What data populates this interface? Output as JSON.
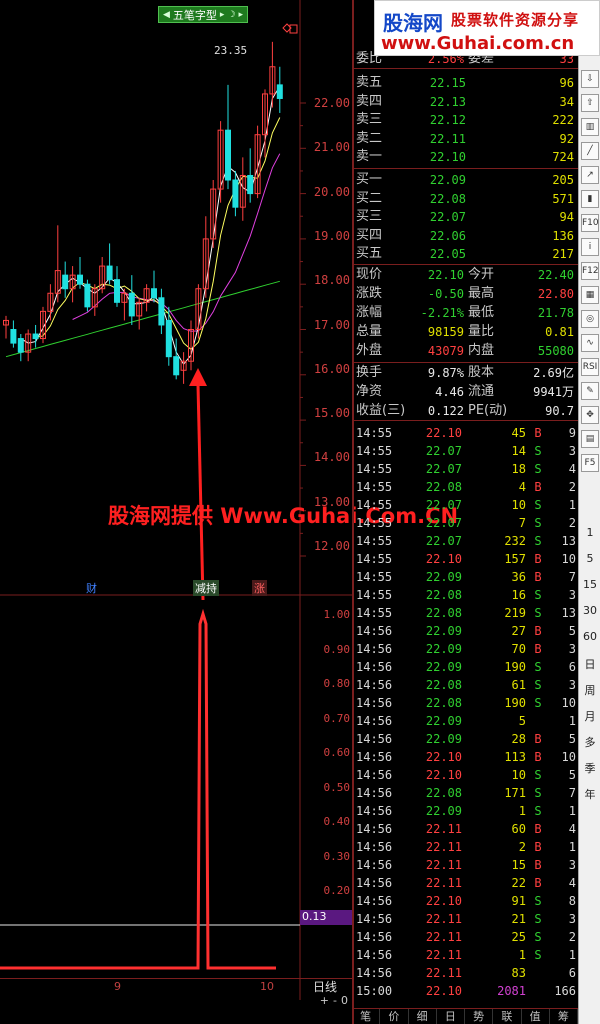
{
  "formula_button": {
    "label": "五笔字型"
  },
  "chart": {
    "price_axis": [
      "22.00",
      "21.00",
      "20.00",
      "19.00",
      "18.00",
      "17.00",
      "16.00",
      "15.00",
      "14.00",
      "13.00",
      "12.00"
    ],
    "indicator_axis": [
      "1.00",
      "0.90",
      "0.80",
      "0.70",
      "0.60",
      "0.50",
      "0.40",
      "0.30",
      "0.20"
    ],
    "high_label": "23.35",
    "events": [
      {
        "label": "财",
        "color": "#4080ff"
      },
      {
        "label": "减持",
        "color": "#ffffff"
      },
      {
        "label": "涨",
        "color": "#ff6060"
      }
    ],
    "indicator_value": "0.13",
    "dates": [
      "9",
      "10"
    ],
    "period_label": "日线",
    "zoom": [
      "+",
      "-",
      "0"
    ],
    "watermark": "股海网提供 Www.Guhai.Com.CN",
    "colors": {
      "up": "#ff4040",
      "down": "#20e0e0",
      "ma5": "#ffffff",
      "ma10": "#ffff60",
      "ma20": "#e040e0",
      "ma60": "#30d030",
      "indicator": "#ff3030"
    }
  },
  "logo": {
    "brand": "股海网",
    "slogan": "股票软件资源分享",
    "url": "www.Guhai.com.cn"
  },
  "quote": {
    "weibi": {
      "label": "委比",
      "value": "2.56%",
      "label2": "委差",
      "value2": "33"
    },
    "asks": [
      {
        "label": "卖五",
        "price": "22.15",
        "vol": "96"
      },
      {
        "label": "卖四",
        "price": "22.13",
        "vol": "34"
      },
      {
        "label": "卖三",
        "price": "22.12",
        "vol": "222"
      },
      {
        "label": "卖二",
        "price": "22.11",
        "vol": "92"
      },
      {
        "label": "卖一",
        "price": "22.10",
        "vol": "724"
      }
    ],
    "bids": [
      {
        "label": "买一",
        "price": "22.09",
        "vol": "205"
      },
      {
        "label": "买二",
        "price": "22.08",
        "vol": "571"
      },
      {
        "label": "买三",
        "price": "22.07",
        "vol": "94"
      },
      {
        "label": "买四",
        "price": "22.06",
        "vol": "136"
      },
      {
        "label": "买五",
        "price": "22.05",
        "vol": "217"
      }
    ],
    "stats1": [
      {
        "l1": "现价",
        "v1": "22.10",
        "c1": "green",
        "l2": "今开",
        "v2": "22.40",
        "c2": "green"
      },
      {
        "l1": "涨跌",
        "v1": "-0.50",
        "c1": "green",
        "l2": "最高",
        "v2": "22.80",
        "c2": "red"
      },
      {
        "l1": "涨幅",
        "v1": "-2.21%",
        "c1": "green",
        "l2": "最低",
        "v2": "21.78",
        "c2": "green"
      },
      {
        "l1": "总量",
        "v1": "98159",
        "c1": "yellow",
        "l2": "量比",
        "v2": "0.81",
        "c2": "yellow"
      },
      {
        "l1": "外盘",
        "v1": "43079",
        "c1": "red",
        "l2": "内盘",
        "v2": "55080",
        "c2": "green"
      }
    ],
    "stats2": [
      {
        "l1": "换手",
        "v1": "9.87%",
        "l2": "股本",
        "v2": "2.69亿"
      },
      {
        "l1": "净资",
        "v1": "4.46",
        "l2": "流通",
        "v2": "9941万"
      },
      {
        "l1": "收益(三)",
        "v1": "0.122",
        "l2": "PE(动)",
        "v2": "90.7"
      }
    ]
  },
  "ticks": [
    {
      "t": "14:55",
      "p": "22.10",
      "v": "45",
      "s": "B",
      "n": "9"
    },
    {
      "t": "14:55",
      "p": "22.07",
      "v": "14",
      "s": "S",
      "n": "3"
    },
    {
      "t": "14:55",
      "p": "22.07",
      "v": "18",
      "s": "S",
      "n": "4"
    },
    {
      "t": "14:55",
      "p": "22.08",
      "v": "4",
      "s": "B",
      "n": "2"
    },
    {
      "t": "14:55",
      "p": "22.07",
      "v": "10",
      "s": "S",
      "n": "1"
    },
    {
      "t": "14:55",
      "p": "22.07",
      "v": "7",
      "s": "S",
      "n": "2"
    },
    {
      "t": "14:55",
      "p": "22.07",
      "v": "232",
      "s": "S",
      "n": "13"
    },
    {
      "t": "14:55",
      "p": "22.10",
      "v": "157",
      "s": "B",
      "n": "10"
    },
    {
      "t": "14:55",
      "p": "22.09",
      "v": "36",
      "s": "B",
      "n": "7"
    },
    {
      "t": "14:55",
      "p": "22.08",
      "v": "16",
      "s": "S",
      "n": "3"
    },
    {
      "t": "14:55",
      "p": "22.08",
      "v": "219",
      "s": "S",
      "n": "13"
    },
    {
      "t": "14:56",
      "p": "22.09",
      "v": "27",
      "s": "B",
      "n": "5"
    },
    {
      "t": "14:56",
      "p": "22.09",
      "v": "70",
      "s": "B",
      "n": "3"
    },
    {
      "t": "14:56",
      "p": "22.09",
      "v": "190",
      "s": "S",
      "n": "6"
    },
    {
      "t": "14:56",
      "p": "22.08",
      "v": "61",
      "s": "S",
      "n": "3"
    },
    {
      "t": "14:56",
      "p": "22.08",
      "v": "190",
      "s": "S",
      "n": "10"
    },
    {
      "t": "14:56",
      "p": "22.09",
      "v": "5",
      "s": "",
      "n": "1"
    },
    {
      "t": "14:56",
      "p": "22.09",
      "v": "28",
      "s": "B",
      "n": "5"
    },
    {
      "t": "14:56",
      "p": "22.10",
      "v": "113",
      "s": "B",
      "n": "10"
    },
    {
      "t": "14:56",
      "p": "22.10",
      "v": "10",
      "s": "S",
      "n": "5"
    },
    {
      "t": "14:56",
      "p": "22.08",
      "v": "171",
      "s": "S",
      "n": "7"
    },
    {
      "t": "14:56",
      "p": "22.09",
      "v": "1",
      "s": "S",
      "n": "1"
    },
    {
      "t": "14:56",
      "p": "22.11",
      "v": "60",
      "s": "B",
      "n": "4"
    },
    {
      "t": "14:56",
      "p": "22.11",
      "v": "2",
      "s": "B",
      "n": "1"
    },
    {
      "t": "14:56",
      "p": "22.11",
      "v": "15",
      "s": "B",
      "n": "3"
    },
    {
      "t": "14:56",
      "p": "22.11",
      "v": "22",
      "s": "B",
      "n": "4"
    },
    {
      "t": "14:56",
      "p": "22.10",
      "v": "91",
      "s": "S",
      "n": "8"
    },
    {
      "t": "14:56",
      "p": "22.11",
      "v": "21",
      "s": "S",
      "n": "3"
    },
    {
      "t": "14:56",
      "p": "22.11",
      "v": "25",
      "s": "S",
      "n": "2"
    },
    {
      "t": "14:56",
      "p": "22.11",
      "v": "1",
      "s": "S",
      "n": "1"
    },
    {
      "t": "14:56",
      "p": "22.11",
      "v": "83",
      "s": "",
      "n": "6"
    },
    {
      "t": "15:00",
      "p": "22.10",
      "v": "2081",
      "s": "",
      "n": "166"
    }
  ],
  "bottom_tabs": [
    "笔",
    "价",
    "细",
    "日",
    "势",
    "联",
    "值",
    "筹"
  ],
  "toolbar_text": [
    "1",
    "5",
    "15",
    "30",
    "60",
    "日",
    "周",
    "月",
    "多",
    "季",
    "年"
  ]
}
